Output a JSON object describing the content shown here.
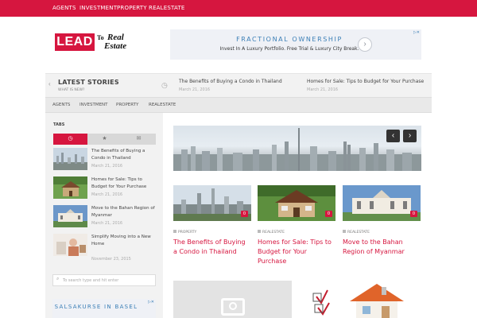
{
  "top_nav": {
    "items": [
      "AGENTS",
      "INVESTMENT",
      "PROPERTY",
      "REALESTATE"
    ]
  },
  "logo": {
    "word1": "LEAD",
    "word2": "To",
    "word3": "Real",
    "word4": "Estate"
  },
  "header_ad": {
    "headline": "FRACTIONAL OWNERSHIP",
    "sub": "Invest In A Luxury Portfolio. Free Trial & Luxury City Break.",
    "arrow": "›",
    "ad_mark": "▷✕"
  },
  "latest": {
    "title": "LATEST STORIES",
    "subtitle": "WHAT IS NEW?",
    "stories": [
      {
        "title": "The Benefits of Buying a Condo in Thailand",
        "date": "March 21, 2016"
      },
      {
        "title": "Homes for Sale: Tips to Budget for Your Purchase",
        "date": "March 21, 2016"
      }
    ]
  },
  "sub_nav": {
    "items": [
      "AGENTS",
      "INVESTMENT",
      "PROPERTY",
      "REALESTATE"
    ]
  },
  "sidebar": {
    "tabs_label": "TABS",
    "tabs": [
      "◷",
      "★",
      "✉"
    ],
    "posts": [
      {
        "title": "The Benefits of Buying a Condo in Thailand",
        "date": "March 21, 2016"
      },
      {
        "title": "Homes for Sale: Tips to Budget for Your Purchase",
        "date": "March 21, 2016"
      },
      {
        "title": "Move to the Bahan Region of Myanmar",
        "date": "March 21, 2016"
      },
      {
        "title": "Simplify Moving into a New Home",
        "date": "November 23, 2015"
      }
    ],
    "search_placeholder": "To search type and hit enter",
    "ad_text": "SALSAKURSE IN BASEL"
  },
  "slider": {
    "prev": "‹",
    "next": "›"
  },
  "cards": [
    {
      "category": "PROPERTY",
      "title": "The Benefits of Buying a Condo in Thailand",
      "comments": "0"
    },
    {
      "category": "REALESTATE",
      "title": "Homes for Sale: Tips to Budget for Your Purchase",
      "comments": "0"
    },
    {
      "category": "REALESTATE",
      "title": "Move to the Bahan Region of Myanmar",
      "comments": "0"
    }
  ],
  "colors": {
    "accent": "#d6163f",
    "link": "#3b7fb6"
  }
}
